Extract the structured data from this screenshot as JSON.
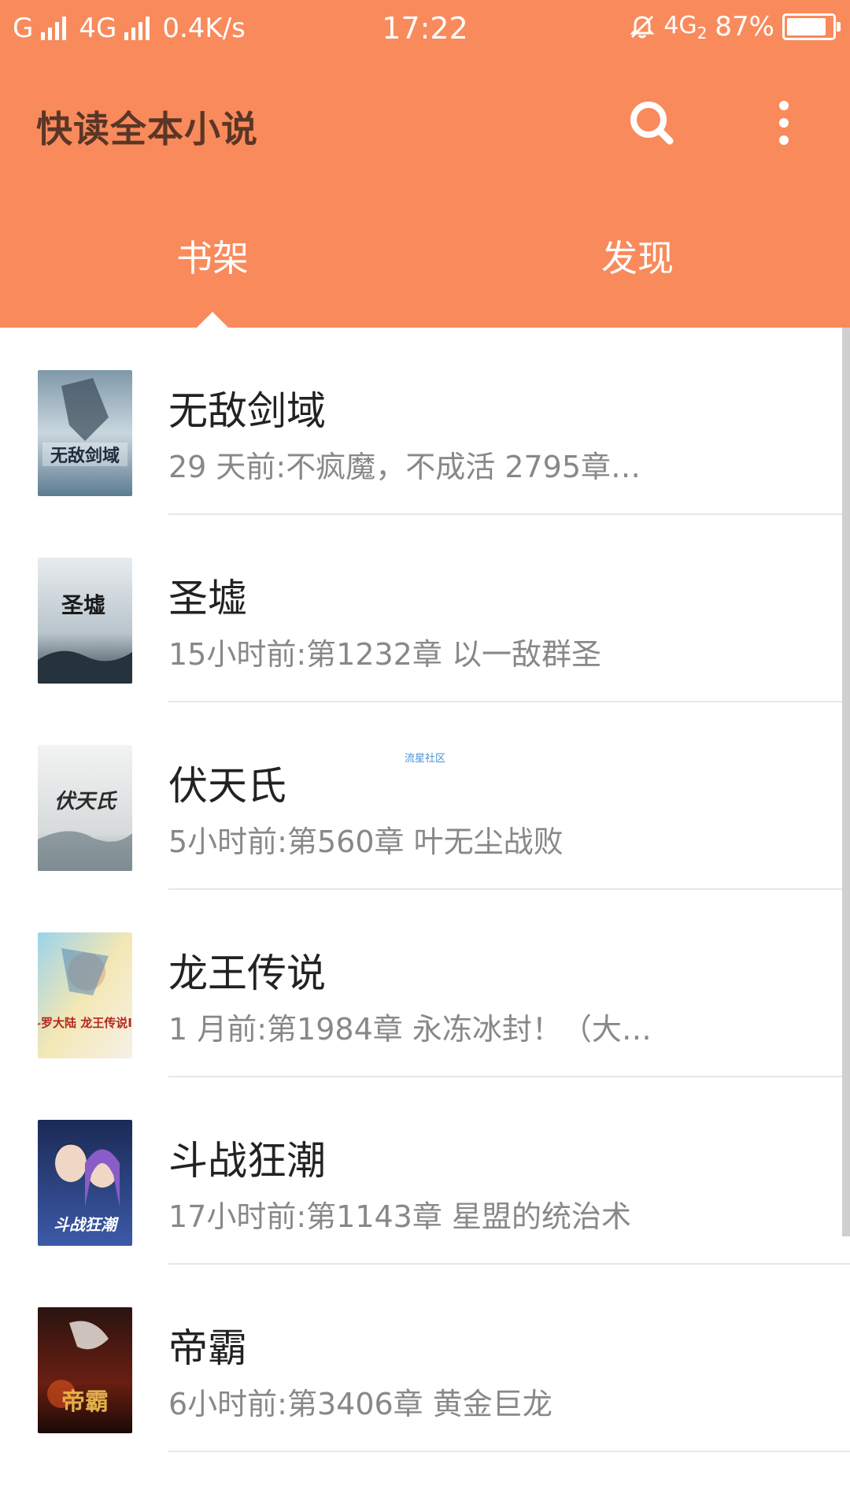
{
  "status_bar": {
    "carrier": "G",
    "network": "4G",
    "speed": "0.4K/s",
    "time": "17:22",
    "right_network": "4G",
    "right_network_sub": "2",
    "battery": "87%",
    "battery_level": 0.87
  },
  "app_bar": {
    "title": "快读全本小说",
    "search_icon": "search-icon",
    "more_icon": "more-vertical-icon"
  },
  "tabs": [
    {
      "label": "书架",
      "active": true
    },
    {
      "label": "发现",
      "active": false
    }
  ],
  "books": [
    {
      "title": "无敌剑域",
      "update": "29 天前:不疯魔，不成活 2795章…",
      "cover_text": "无敌剑域"
    },
    {
      "title": "圣墟",
      "update": "15小时前:第1232章 以一敌群圣",
      "cover_text": "圣墟"
    },
    {
      "title": "伏天氏",
      "update": "5小时前:第560章 叶无尘战败",
      "cover_text": "伏天氏"
    },
    {
      "title": "龙王传说",
      "update": "1 月前:第1984章 永冻冰封！（大…",
      "cover_text": "斗罗大陆 龙王传说III"
    },
    {
      "title": "斗战狂潮",
      "update": "17小时前:第1143章 星盟的统治术",
      "cover_text": "斗战狂潮"
    },
    {
      "title": "帝霸",
      "update": "6小时前:第3406章 黄金巨龙",
      "cover_text": "帝霸"
    }
  ],
  "watermark": "流星社区",
  "colors": {
    "primary": "#F98A5C",
    "title_text": "#5a3626",
    "tab_text": "#ffffff",
    "book_title": "#222222",
    "book_update": "#888888"
  }
}
